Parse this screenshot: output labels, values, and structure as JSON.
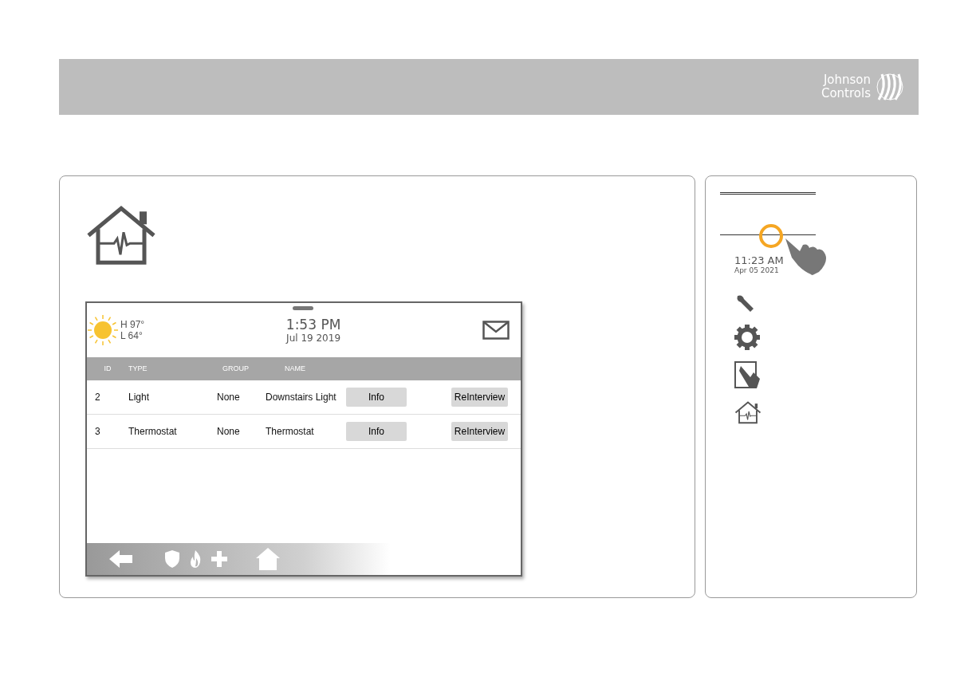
{
  "header": {
    "logo": [
      "Johnson",
      "Controls"
    ]
  },
  "panel": {
    "weather": {
      "high": "H 97°",
      "low": "L 64°"
    },
    "time": "1:53 PM",
    "date": "Jul 19 2019",
    "table": {
      "columns": [
        "ID",
        "TYPE",
        "GROUP",
        "NAME"
      ],
      "rows": [
        {
          "id": "2",
          "type": "Light",
          "group": "None",
          "name": "Downstairs Light",
          "buttons": [
            "Info",
            "ReInterview"
          ]
        },
        {
          "id": "3",
          "type": "Thermostat",
          "group": "None",
          "name": "Thermostat",
          "buttons": [
            "Info",
            "ReInterview"
          ]
        }
      ]
    }
  },
  "sidebar": {
    "time": "11:23 AM",
    "date": "Apr 05 2021"
  }
}
